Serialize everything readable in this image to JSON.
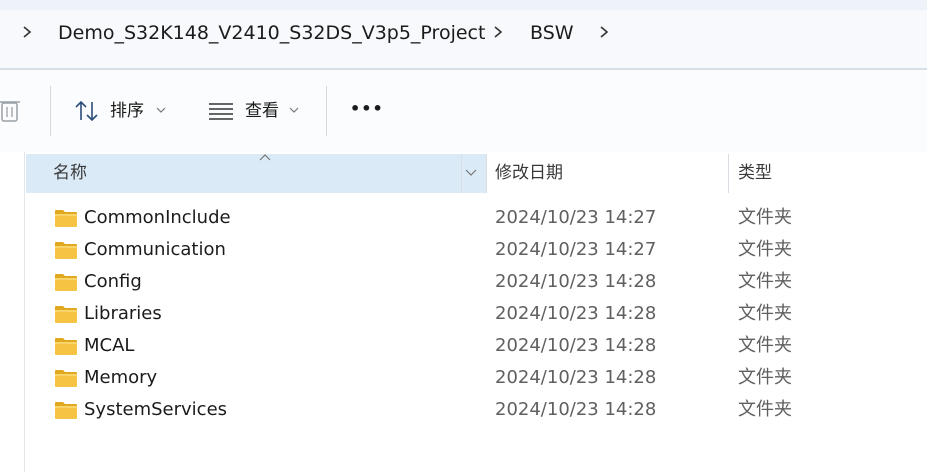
{
  "breadcrumb": {
    "items": [
      {
        "label": "Demo_S32K148_V2410_S32DS_V3p5_Project"
      },
      {
        "label": "BSW"
      }
    ]
  },
  "toolbar": {
    "sort_label": "排序",
    "view_label": "查看",
    "more_label": "•••"
  },
  "columns": {
    "name": "名称",
    "date_modified": "修改日期",
    "type": "类型"
  },
  "files": [
    {
      "name": "CommonInclude",
      "date": "2024/10/23 14:27",
      "type": "文件夹"
    },
    {
      "name": "Communication",
      "date": "2024/10/23 14:27",
      "type": "文件夹"
    },
    {
      "name": "Config",
      "date": "2024/10/23 14:28",
      "type": "文件夹"
    },
    {
      "name": "Libraries",
      "date": "2024/10/23 14:28",
      "type": "文件夹"
    },
    {
      "name": "MCAL",
      "date": "2024/10/23 14:28",
      "type": "文件夹"
    },
    {
      "name": "Memory",
      "date": "2024/10/23 14:28",
      "type": "文件夹"
    },
    {
      "name": "SystemServices",
      "date": "2024/10/23 14:28",
      "type": "文件夹"
    }
  ],
  "colors": {
    "header_selected": "#dbeaf7",
    "folder_yellow": "#f6c342"
  }
}
